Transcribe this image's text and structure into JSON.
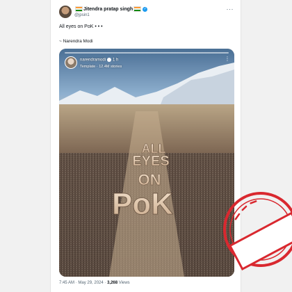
{
  "tweet": {
    "display_name": "Jitendra pratap singh",
    "handle": "@jpsin1",
    "line1": "All eyes on PoK",
    "line1_emoji": "• • •",
    "line2": "~ Narendra Modi",
    "more": "···",
    "time": "7:45 AM",
    "date": "May 29, 2024",
    "views_count": "3,268",
    "views_label": "Views"
  },
  "story": {
    "username": "narendramodi",
    "age": "1 h",
    "subtitle": "Template · 12.4M stories",
    "image_text": [
      "ALL",
      "EYES",
      "ON",
      "PoK"
    ]
  },
  "colors": {
    "verified": "#1d9bf0",
    "stamp": "#d9282f"
  },
  "icons": {
    "verified": "verified-badge-icon",
    "more": "more-options-icon",
    "stamp": "fake-stamp-icon"
  }
}
